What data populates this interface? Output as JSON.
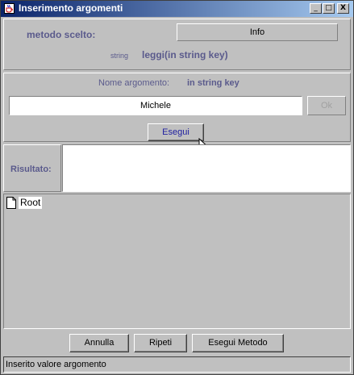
{
  "window": {
    "title": "Inserimento argomenti",
    "controls": {
      "minimize": "_",
      "maximize": "□",
      "close": "X"
    },
    "title_icon": "java-cup-icon"
  },
  "method_section": {
    "label": "metodo scelto:",
    "info_button": "Info",
    "return_type": "string",
    "signature": "leggi(in string key)"
  },
  "argument_section": {
    "name_label": "Nome argomento:",
    "name_value": "in string key",
    "input_value": "Michele",
    "ok_button": "Ok",
    "execute_button": "Esegui"
  },
  "result_section": {
    "label": "Risultato:",
    "value": ""
  },
  "tree": {
    "root_label": "Root",
    "root_icon": "document-icon"
  },
  "bottom_buttons": {
    "cancel": "Annulla",
    "repeat": "Ripeti",
    "execute_method": "Esegui Metodo"
  },
  "status_bar": {
    "text": "Inserito valore argomento"
  },
  "colors": {
    "title_gradient_start": "#0a246a",
    "title_gradient_end": "#a6caf0",
    "label_text": "#5a5a8c",
    "execute_text": "#2020a0"
  }
}
